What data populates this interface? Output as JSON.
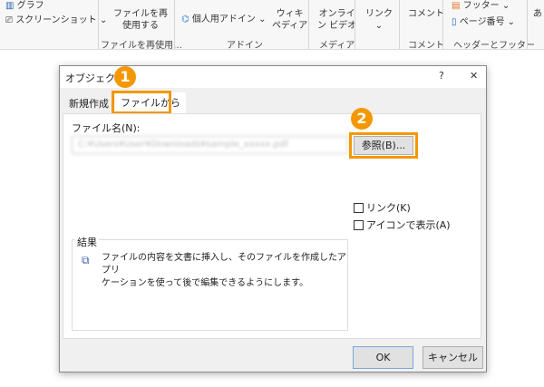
{
  "ribbon": {
    "chart": "グラフ",
    "screenshot": "スクリーンショット ⌄",
    "reuse_file": [
      "ファイルを再",
      "使用する"
    ],
    "reuse_group": "ファイルを再使用…",
    "personal_addin": "個人用アドイン",
    "addin_chevron": "⌄",
    "wikipedia": [
      "ウィキ",
      "ペディア"
    ],
    "addin_group": "アドイン",
    "online_video": [
      "オンライ",
      "ン ビデオ"
    ],
    "media_group": "メディア",
    "link": "リンク",
    "link_chevron": "⌄",
    "comment": "コメント",
    "comment_group": "コメント",
    "footer": "フッター ⌄",
    "page_number": "ページ番号 ⌄",
    "hf_group": "ヘッダーとフッター",
    "cut_text": "あ"
  },
  "dialog": {
    "title": "オブジェクトの",
    "help": "?",
    "close": "✕",
    "tabs": [
      "新規作成",
      "ファイルから"
    ],
    "file_label": "ファイル名(N):",
    "file_value": "C:¥Users¥User¥Downloads¥sample_xxxxx.pdf",
    "browse": "参照(B)...",
    "link": "リンク(K)",
    "show_icon": "アイコンで表示(A)",
    "result_label": "結果",
    "result_text": [
      "ファイルの内容を文書に挿入し、そのファイルを作成したアプリ",
      "ケーションを使って後で編集できるようにします。"
    ],
    "ok": "OK",
    "cancel": "キャンセル"
  },
  "badges": [
    "1",
    "2"
  ],
  "colors": {
    "accent": "#f39800"
  }
}
